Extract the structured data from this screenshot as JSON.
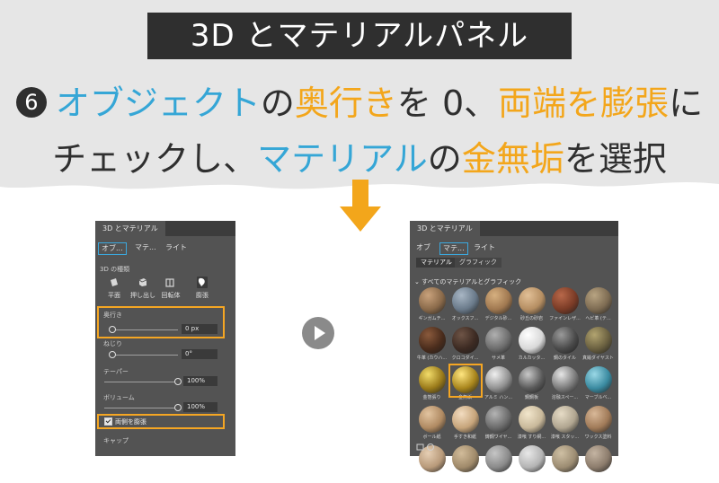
{
  "header": {
    "title": "3D とマテリアルパネル",
    "step_number": "6",
    "line1": [
      {
        "text": "オブジェクト",
        "color": "blue"
      },
      {
        "text": "の",
        "color": "dark"
      },
      {
        "text": "奥行き",
        "color": "orange"
      },
      {
        "text": "を 0、",
        "color": "dark"
      },
      {
        "text": "両端を膨張",
        "color": "orange"
      },
      {
        "text": "に",
        "color": "dark"
      }
    ],
    "line2": [
      {
        "text": "チェックし、",
        "color": "dark"
      },
      {
        "text": "マテリアル",
        "color": "blue"
      },
      {
        "text": "の",
        "color": "dark"
      },
      {
        "text": "金無垢",
        "color": "orange"
      },
      {
        "text": "を選択",
        "color": "dark"
      }
    ]
  },
  "colors": {
    "blue": "#35a6d6",
    "orange": "#f3a61b",
    "dark": "#2f2f2f",
    "highlight": "#f5a623",
    "tab_outline": "#3ba9df"
  },
  "left_panel": {
    "tab_title": "3D とマテリアル",
    "subtabs": [
      "オブ...",
      "マテ...",
      "ライト"
    ],
    "section_3d_type": "3D の種類",
    "types": [
      "平面",
      "押し出し",
      "回転体",
      "膨張"
    ],
    "depth_label": "奥行き",
    "depth_value": "0 px",
    "depth_level": 0,
    "twist_label": "ねじり",
    "twist_value": "0°",
    "twist_level": 0,
    "taper_label": "テーパー",
    "taper_value": "100%",
    "taper_level": 1,
    "volume_label": "ボリューム",
    "volume_value": "100%",
    "volume_level": 1,
    "inflate_both_label": "両側を膨張",
    "inflate_both_checked": true,
    "cap_label": "キャップ"
  },
  "right_panel": {
    "tab_title": "3D とマテリアル",
    "subtabs": [
      "オブ",
      "マテ...",
      "ライト"
    ],
    "toggle_tabs": [
      "マテリアル",
      "グラフィック"
    ],
    "section_all": "すべてのマテリアルとグラフィック",
    "materials": [
      {
        "label": "ギンガムチ...",
        "color": "#8a6a4a",
        "hl": "#c9a27c"
      },
      {
        "label": "オックスフ...",
        "color": "#6a7a8a",
        "hl": "#a8b6c4"
      },
      {
        "label": "デジタル砂...",
        "color": "#a07850",
        "hl": "#d6b080"
      },
      {
        "label": "砂丘の砂岩",
        "color": "#b58e62",
        "hl": "#e2c097"
      },
      {
        "label": "ファインレザ...",
        "color": "#7a3b26",
        "hl": "#b8684a"
      },
      {
        "label": "ヘビ革 (テ...",
        "color": "#7d6b52",
        "hl": "#b8a482"
      },
      {
        "label": "牛革 (カウハ...",
        "color": "#4a2c1c",
        "hl": "#8a5a3c"
      },
      {
        "label": "クロコダイ...",
        "color": "#3c2a22",
        "hl": "#6e5446"
      },
      {
        "label": "サメ革",
        "color": "#6c6c6c",
        "hl": "#b0b0b0"
      },
      {
        "label": "カルカッタ...",
        "color": "#d8d8d8",
        "hl": "#ffffff"
      },
      {
        "label": "鋼のタイル",
        "color": "#4a4a4a",
        "hl": "#9a9a9a"
      },
      {
        "label": "真鍮ダイヤスト...",
        "color": "#6a6040",
        "hl": "#b2a470"
      },
      {
        "label": "金箔張り",
        "color": "#9a7a1a",
        "hl": "#f2dc6a"
      },
      {
        "label": "金無垢",
        "color": "#a8851c",
        "hl": "#ffe680"
      },
      {
        "label": "アルミ ハン...",
        "color": "#909090",
        "hl": "#f0f0f0"
      },
      {
        "label": "鋼鋼板",
        "color": "#5a5a5a",
        "hl": "#c8c8c8"
      },
      {
        "label": "溶融スペー...",
        "color": "#7a7a7a",
        "hl": "#e6e6e6"
      },
      {
        "label": "マーブルベ...",
        "color": "#3a8aa0",
        "hl": "#9ad8e6"
      },
      {
        "label": "ボール紙",
        "color": "#b08a62",
        "hl": "#e2c4a0"
      },
      {
        "label": "手すき和紙",
        "color": "#c6a47a",
        "hl": "#f2dcc0"
      },
      {
        "label": "鋳鋼ワイヤ...",
        "color": "#6a6a6a",
        "hl": "#b4b4b4"
      },
      {
        "label": "漆喰 すり網...",
        "color": "#c8b89a",
        "hl": "#f2e6cc"
      },
      {
        "label": "漆喰 スタッ...",
        "color": "#b0a590",
        "hl": "#e6dcc6"
      },
      {
        "label": "ワックス塗料",
        "color": "#a07a58",
        "hl": "#d8b898"
      },
      {
        "label": "",
        "color": "#b89a7a",
        "hl": "#e6cfb4"
      },
      {
        "label": "",
        "color": "#a08a6a",
        "hl": "#d2bc9a"
      },
      {
        "label": "",
        "color": "#8a8a8a",
        "hl": "#c6c6c6"
      },
      {
        "label": "",
        "color": "#b4b4b4",
        "hl": "#e8e8e8"
      },
      {
        "label": "",
        "color": "#9c8c72",
        "hl": "#cfc0a4"
      },
      {
        "label": "",
        "color": "#8c7c6c",
        "hl": "#c4b4a2"
      }
    ],
    "selected_material": "金無垢"
  }
}
